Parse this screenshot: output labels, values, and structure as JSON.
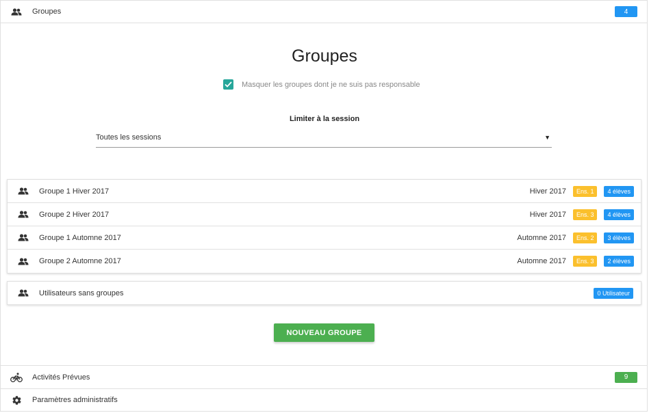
{
  "header_groupes": {
    "label": "Groupes",
    "count": "4",
    "icon": "people-icon"
  },
  "main": {
    "title": "Groupes",
    "hide_checkbox": {
      "checked": true,
      "label": "Masquer les groupes dont je ne suis pas responsable"
    },
    "session_label": "Limiter à la session",
    "session_select": {
      "value": "Toutes les sessions"
    },
    "groups": [
      {
        "name": "Groupe 1 Hiver 2017",
        "session": "Hiver 2017",
        "teacher": "Ens. 1",
        "students": "4 élèves"
      },
      {
        "name": "Groupe 2 Hiver 2017",
        "session": "Hiver 2017",
        "teacher": "Ens. 3",
        "students": "4 élèves"
      },
      {
        "name": "Groupe 1 Automne 2017",
        "session": "Automne 2017",
        "teacher": "Ens. 2",
        "students": "3 élèves"
      },
      {
        "name": "Groupe 2 Automne 2017",
        "session": "Automne 2017",
        "teacher": "Ens. 3",
        "students": "2 élèves"
      }
    ],
    "no_group": {
      "label": "Utilisateurs sans groupes",
      "count": "0 Utilisateur"
    },
    "new_group_button": "NOUVEAU GROUPE"
  },
  "header_activites": {
    "label": "Activités Prévues",
    "count": "9",
    "icon": "bicycle-icon"
  },
  "header_params": {
    "label": "Paramètres administratifs",
    "icon": "gear-icon"
  },
  "colors": {
    "blue": "#2196f3",
    "green": "#4caf50",
    "yellow": "#fbc02d",
    "teal": "#26a69a"
  }
}
